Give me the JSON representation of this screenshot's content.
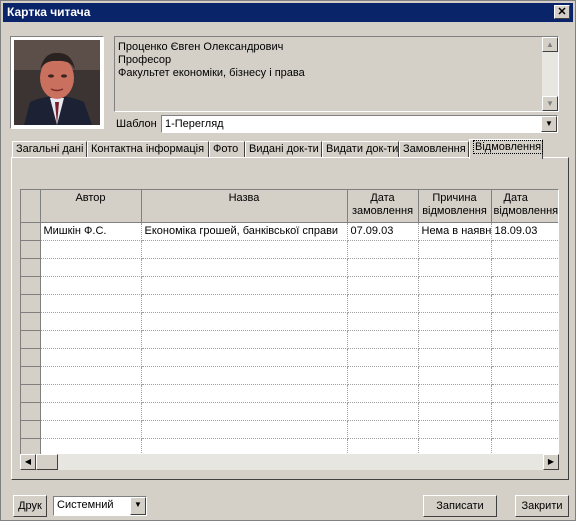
{
  "window": {
    "title": "Картка читача",
    "close_glyph": "✕"
  },
  "profile": {
    "name": "Проценко Євген Олександрович",
    "position": "Професор",
    "faculty": "Факультет економіки, бізнесу і права"
  },
  "template": {
    "label": "Шаблон",
    "value": "1-Перегляд"
  },
  "tabs": [
    {
      "label": "Загальні дані"
    },
    {
      "label": "Контактна інформація"
    },
    {
      "label": "Фото"
    },
    {
      "label": "Видані док-ти"
    },
    {
      "label": "Видати док-ти"
    },
    {
      "label": "Замовлення"
    },
    {
      "label": "Відмовлення"
    }
  ],
  "table": {
    "columns": [
      {
        "line1": "Автор",
        "line2": ""
      },
      {
        "line1": "Назва",
        "line2": ""
      },
      {
        "line1": "Дата",
        "line2": "замовлення"
      },
      {
        "line1": "Причина",
        "line2": "відмовлення"
      },
      {
        "line1": "Дата",
        "line2": "відмовлення"
      }
    ],
    "rows": [
      {
        "author": "Мишкін Ф.С.",
        "title": "Економіка грошей, банківської справи",
        "order_date": "07.09.03",
        "reason": "Нема в наявн",
        "refusal_date": "18.09.03"
      }
    ]
  },
  "footer": {
    "print_label": "Друк",
    "style_value": "Системний",
    "save_label": "Записати",
    "close_label": "Закрити"
  },
  "colors": {
    "titlebar": "#0a246a",
    "face": "#d4d0c8"
  }
}
